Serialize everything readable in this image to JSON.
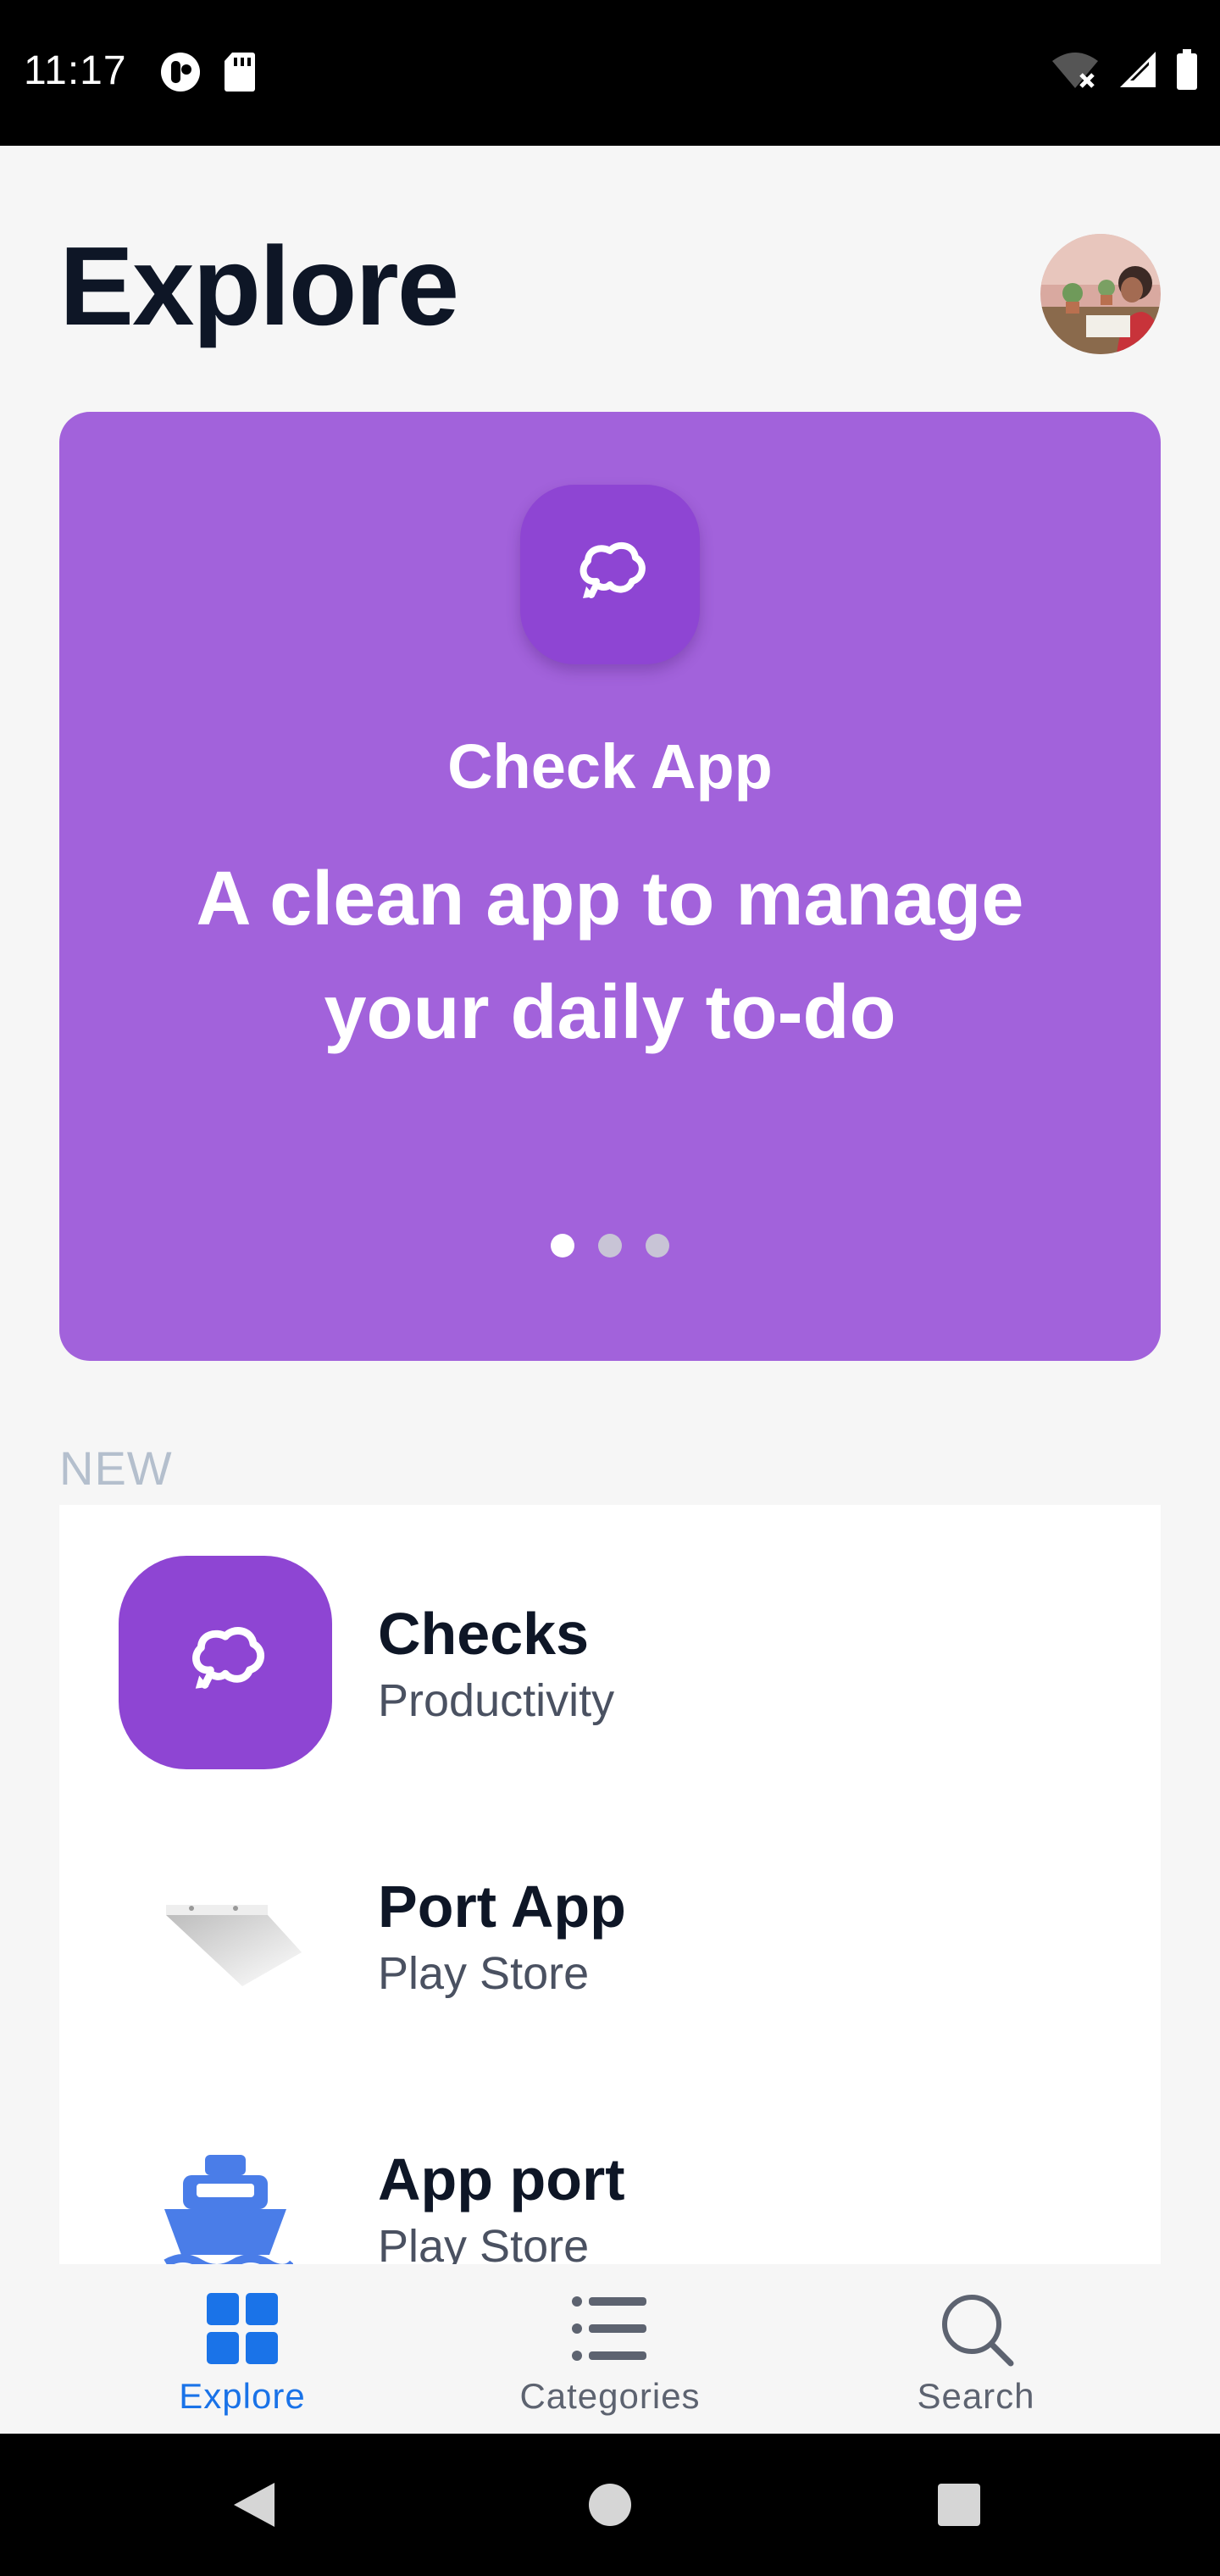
{
  "status_bar": {
    "time": "11:17"
  },
  "header": {
    "title": "Explore"
  },
  "featured": {
    "app_name": "Check App",
    "tagline": "A clean app to manage your daily to-do",
    "background_color": "#a262db",
    "icon": "checks-logo-icon",
    "page_count": 3,
    "active_page": 1
  },
  "section": {
    "label": "NEW"
  },
  "app_list": [
    {
      "name": "Checks",
      "category": "Productivity",
      "icon": "checks-logo-icon"
    },
    {
      "name": "Port App",
      "category": "Play Store",
      "icon": "port-app-logo-icon"
    },
    {
      "name": "App port",
      "category": "Play Store",
      "icon": "ship-logo-icon"
    }
  ],
  "bottom_nav": {
    "items": [
      {
        "label": "Explore",
        "icon": "grid-icon",
        "active": true
      },
      {
        "label": "Categories",
        "icon": "list-icon",
        "active": false
      },
      {
        "label": "Search",
        "icon": "search-icon",
        "active": false
      }
    ]
  },
  "colors": {
    "accent": "#1a73e8",
    "brand_purple": "#8e45d3"
  }
}
